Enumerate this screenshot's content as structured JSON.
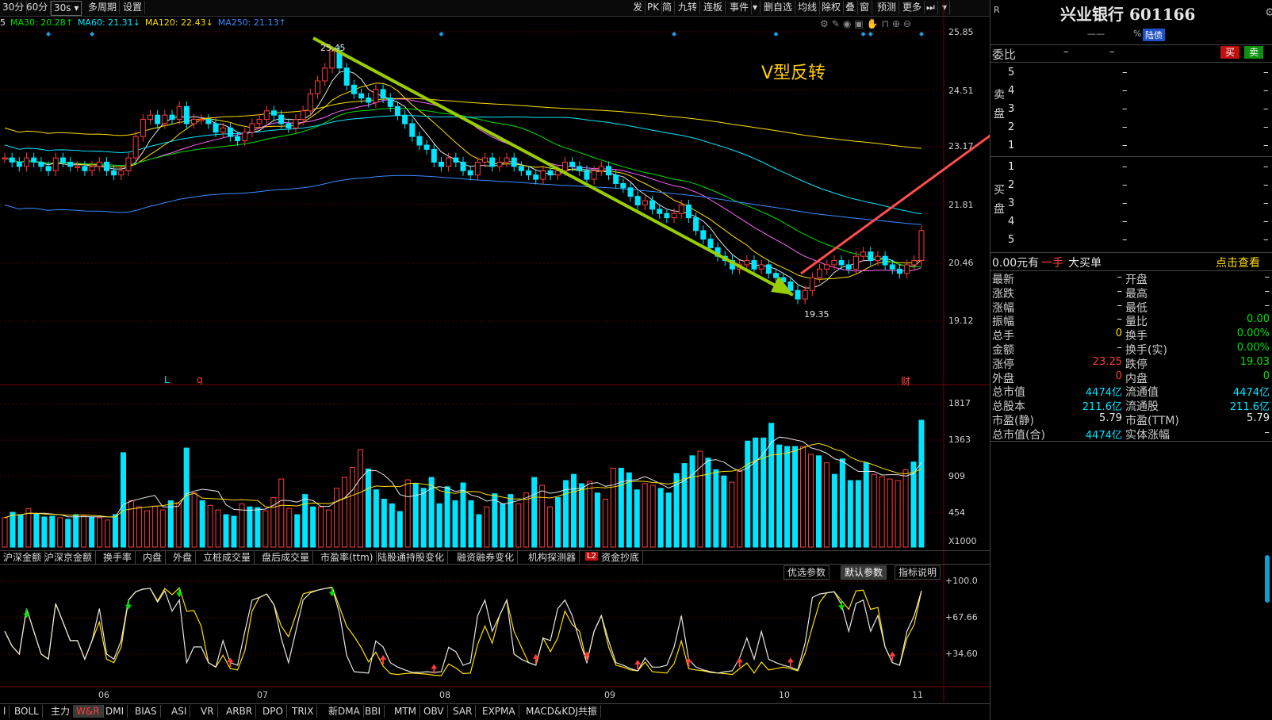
{
  "toolbar": {
    "left_buttons": [
      "30分",
      "60分",
      "30s ▾",
      "多周期",
      "设置"
    ],
    "right_buttons": [
      "发",
      "PK",
      "简",
      "九转",
      "连板",
      "事件",
      "▾",
      "删自选",
      "均线",
      "除权",
      "叠",
      "窗",
      "预测",
      "更多",
      "⏭",
      "▾"
    ]
  },
  "ma_legend": [
    {
      "label": "5",
      "color": "#e6e6e6"
    },
    {
      "label": "MA30: 20.28↑",
      "color": "#00e000"
    },
    {
      "label": "MA60: 21.31↓",
      "color": "#00e5ff"
    },
    {
      "label": "MA120: 22.43↓",
      "color": "#ffde00"
    },
    {
      "label": "MA250: 21.13↑",
      "color": "#3a8cff"
    }
  ],
  "annotation_title": "V型反转",
  "price_axis": [
    "25.85",
    "24.51",
    "23.17",
    "21.81",
    "20.46",
    "19.12"
  ],
  "price_marks": {
    "high": "25.45",
    "low": "19.35"
  },
  "event_markers": [
    "L",
    "q",
    "财"
  ],
  "volume_axis": [
    "1817",
    "1363",
    "909",
    "454",
    "X1000"
  ],
  "indicator_tabs": [
    "沪深金额",
    "沪深京金额",
    "换手率",
    "内盘",
    "外盘",
    "立桩成交量",
    "盘后成交量",
    "市盈率(ttm)",
    "陆股通持股变化",
    "融资融券变化",
    "机构探测器",
    "资金抄底"
  ],
  "indicator_badge": "L2",
  "wr_param_buttons": [
    "优选参数",
    "默认参数",
    "指标说明"
  ],
  "wr_axis": [
    "+100.0",
    "+67.66",
    "+34.60"
  ],
  "x_axis_months": [
    "06",
    "07",
    "08",
    "09",
    "10",
    "11"
  ],
  "bottom_tabs": [
    "BOLL",
    "主力",
    "W&R",
    "DMI",
    "BIAS",
    "ASI",
    "VR",
    "ARBR",
    "DPO",
    "TRIX",
    "新DMA",
    "BBI",
    "MTM",
    "OBV",
    "SAR",
    "EXPMA",
    "MACD&KDJ共振"
  ],
  "bottom_first": "l",
  "quote": {
    "title": "兴业银行 601166",
    "r_badge": "R",
    "sub_dash": "——",
    "sub_pct": "%",
    "hk_badge": "陆债",
    "weibi_label": "委比",
    "weibi_val": "–",
    "weibi_val2": "–",
    "buy_btn": "买",
    "sell_btn": "卖",
    "sell_label": "卖盘",
    "buy_label": "买盘",
    "levels_sell": [
      "5",
      "4",
      "3",
      "2",
      "1"
    ],
    "levels_buy": [
      "1",
      "2",
      "3",
      "4",
      "5"
    ],
    "dash": "–",
    "bigorder_left": "0.00元有",
    "bigorder_mid": "一手",
    "bigorder_label": "大买单",
    "bigorder_link": "点击查看",
    "stats": [
      {
        "l": "最新",
        "lv": "–",
        "r": "开盘",
        "rv": "–"
      },
      {
        "l": "涨跌",
        "lv": "–",
        "r": "最高",
        "rv": "–"
      },
      {
        "l": "涨幅",
        "lv": "–",
        "r": "最低",
        "rv": "–"
      },
      {
        "l": "振幅",
        "lv": "–",
        "r": "量比",
        "rv": "0.00"
      },
      {
        "l": "总手",
        "lv": "0",
        "r": "换手",
        "rv": "0.00%"
      },
      {
        "l": "金额",
        "lv": "–",
        "r": "换手(实)",
        "rv": "0.00%"
      },
      {
        "l": "涨停",
        "lv": "23.25",
        "r": "跌停",
        "rv": "19.03"
      },
      {
        "l": "外盘",
        "lv": "0",
        "r": "内盘",
        "rv": "0"
      },
      {
        "l": "总市值",
        "lv": "4474亿",
        "r": "流通值",
        "rv": "4474亿"
      },
      {
        "l": "总股本",
        "lv": "211.6亿",
        "r": "流通股",
        "rv": "211.6亿"
      },
      {
        "l": "市盈(静)",
        "lv": "5.79",
        "r": "市盈(TTM)",
        "rv": "5.79"
      },
      {
        "l": "总市值(合)",
        "lv": "4474亿",
        "r": "实体涨幅",
        "rv": "–"
      }
    ]
  },
  "chart_data": {
    "type": "candlestick",
    "title": "兴业银行 601166",
    "price_range": [
      19.12,
      25.85
    ],
    "closes": [
      22.9,
      22.8,
      22.7,
      22.9,
      22.8,
      22.7,
      22.6,
      22.9,
      22.8,
      22.7,
      22.7,
      22.6,
      22.7,
      22.8,
      22.6,
      22.5,
      22.6,
      22.9,
      23.4,
      23.8,
      23.9,
      23.7,
      23.9,
      23.8,
      24.1,
      23.7,
      23.8,
      23.8,
      23.7,
      23.5,
      23.6,
      23.4,
      23.3,
      23.5,
      23.7,
      23.8,
      24.0,
      23.9,
      23.7,
      23.6,
      23.8,
      24.0,
      24.4,
      24.7,
      25.0,
      25.4,
      25.0,
      24.6,
      24.4,
      24.3,
      24.2,
      24.5,
      24.3,
      24.1,
      23.9,
      23.7,
      23.4,
      23.2,
      23.1,
      22.8,
      22.7,
      22.9,
      22.8,
      22.6,
      22.5,
      22.8,
      22.9,
      22.7,
      22.8,
      22.9,
      22.7,
      22.6,
      22.5,
      22.4,
      22.6,
      22.5,
      22.6,
      22.8,
      22.7,
      22.6,
      22.4,
      22.6,
      22.7,
      22.5,
      22.3,
      22.2,
      22.0,
      21.8,
      21.9,
      21.7,
      21.6,
      21.5,
      21.6,
      21.8,
      21.5,
      21.2,
      21.0,
      20.8,
      20.6,
      20.5,
      20.3,
      20.4,
      20.5,
      20.3,
      20.4,
      20.2,
      20.1,
      20.0,
      19.8,
      19.6,
      19.8,
      20.1,
      20.3,
      20.4,
      20.5,
      20.4,
      20.3,
      20.6,
      20.7,
      20.5,
      20.6,
      20.4,
      20.3,
      20.2,
      20.4,
      20.5,
      21.2
    ],
    "volume_range": [
      0,
      1817
    ],
    "volumes": [
      380,
      450,
      420,
      500,
      430,
      390,
      400,
      380,
      360,
      420,
      410,
      390,
      380,
      350,
      420,
      1220,
      600,
      520,
      470,
      530,
      480,
      600,
      560,
      1280,
      700,
      600,
      540,
      480,
      420,
      400,
      560,
      520,
      510,
      470,
      640,
      880,
      500,
      420,
      680,
      520,
      520,
      480,
      760,
      900,
      1030,
      1260,
      1010,
      740,
      620,
      560,
      460,
      870,
      820,
      760,
      900,
      560,
      780,
      600,
      830,
      600,
      420,
      520,
      690,
      560,
      680,
      560,
      700,
      900,
      800,
      520,
      640,
      860,
      940,
      820,
      850,
      700,
      620,
      1020,
      1020,
      960,
      740,
      820,
      800,
      760,
      700,
      950,
      1080,
      1180,
      1240,
      1150,
      1000,
      920,
      840,
      980,
      1370,
      1410,
      1410,
      1600,
      1320,
      1300,
      1300,
      1300,
      1200,
      1180,
      1090,
      940,
      1140,
      860,
      860,
      1090,
      940,
      910,
      880,
      860,
      1000,
      1100,
      1640
    ],
    "series": [
      {
        "name": "MA30",
        "color": "#00e000"
      },
      {
        "name": "MA60",
        "color": "#00e5ff"
      },
      {
        "name": "MA120",
        "color": "#ffde00"
      },
      {
        "name": "MA250",
        "color": "#3a8cff"
      }
    ],
    "wr_range": [
      0,
      100
    ],
    "x_labels": [
      "06",
      "07",
      "08",
      "09",
      "10",
      "11"
    ]
  }
}
